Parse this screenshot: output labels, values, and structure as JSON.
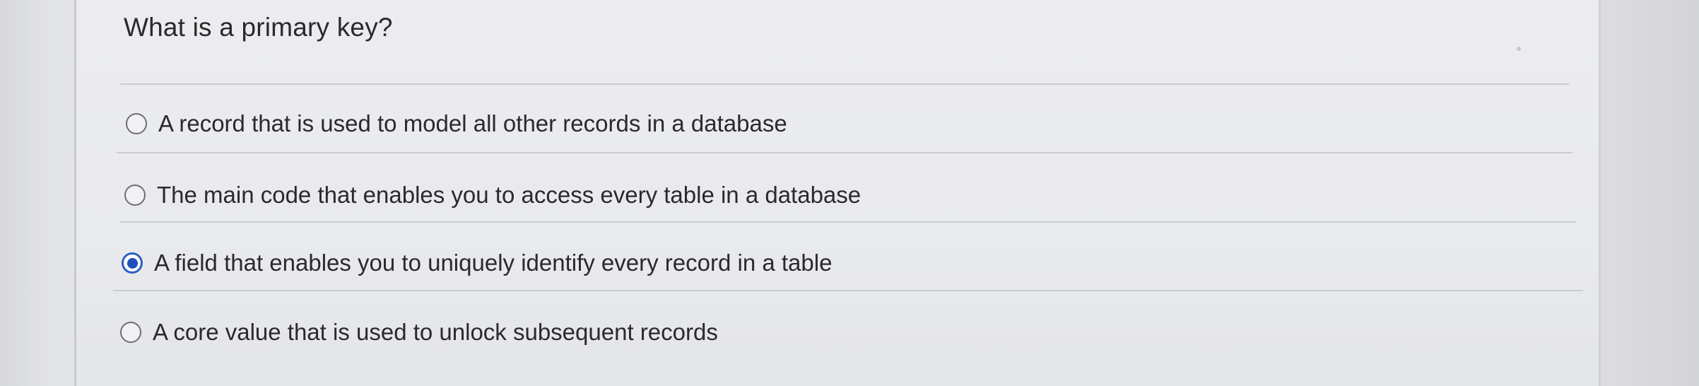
{
  "question": {
    "text": "What is a primary key?"
  },
  "options": [
    {
      "label": "A record that is used to model all other records in a database",
      "selected": false
    },
    {
      "label": "The main code that enables you to access every table in a database",
      "selected": false
    },
    {
      "label": "A field that enables you to uniquely identify every record in a table",
      "selected": true
    },
    {
      "label": "A core value that is used to unlock subsequent records",
      "selected": false
    }
  ],
  "colors": {
    "selected_radio": "#1f4fb8",
    "text": "#2a2a2c",
    "divider": "#cbccd0"
  }
}
